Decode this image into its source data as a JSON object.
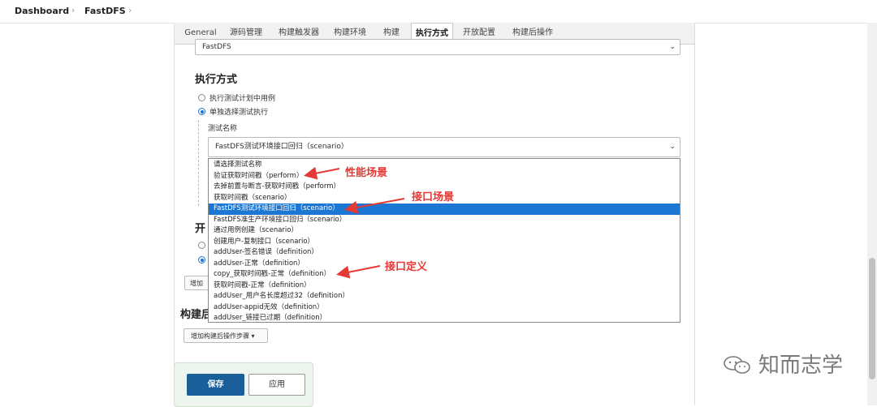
{
  "breadcrumb": {
    "items": [
      "Dashboard",
      "FastDFS"
    ],
    "separator": "›"
  },
  "tabs": [
    "General",
    "源码管理",
    "构建触发器",
    "构建环境",
    "构建",
    "执行方式",
    "开放配置",
    "构建后操作"
  ],
  "active_tab": "执行方式",
  "top_select": {
    "value": "FastDFS"
  },
  "exec_section": {
    "title": "执行方式",
    "options": [
      "执行测试计划中用例",
      "单独选择测试执行"
    ],
    "selected_option": 1,
    "test_name_label": "测试名称",
    "test_select_value": "FastDFS测试环境接口回归（scenario）"
  },
  "dropdown": {
    "items": [
      "请选择测试名称",
      "验证获取时间戳（perform）",
      "去掉前置与断言-获取时间戳（perform）",
      "获取时间戳（scenario）",
      "FastDFS测试环境接口回归（scenario）",
      "FastDFS准生产环境接口回归（scenario）",
      "通过用例创建（scenario）",
      "创建用户-复制接口（scenario）",
      "addUser-签名错误（definition）",
      "addUser-正常（definition）",
      "copy_获取时间戳-正常（definition）",
      "获取时间戳-正常（definition）",
      "addUser_用户名长度超过32（definition）",
      "addUser-appid无效（definition）",
      "addUser_链接已过期（definition）"
    ],
    "selected_index": 4
  },
  "hidden_section_partial": {
    "title_fragment": "开",
    "add_button_fragment": "增加"
  },
  "post_build": {
    "title_fragment": "构建后",
    "add_step_label": "增加构建后操作步骤 ▾"
  },
  "buttons": {
    "save": "保存",
    "apply": "应用"
  },
  "annotations": {
    "perf": "性能场景",
    "iface_scenario": "接口场景",
    "iface_def": "接口定义",
    "color": "#e53935"
  },
  "watermark": {
    "text": "知而志学"
  },
  "colors": {
    "accent": "#1c77d2",
    "save_bg": "#1a5f9a"
  }
}
